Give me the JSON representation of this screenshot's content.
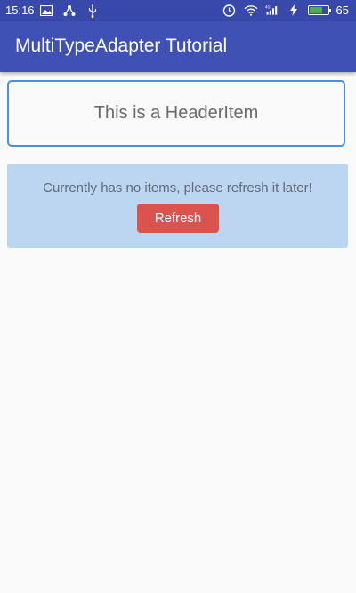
{
  "status_bar": {
    "time": "15:16",
    "battery_level": "65",
    "icons": [
      "image-icon",
      "share-icon",
      "usb-icon",
      "alarm-icon",
      "wifi-icon",
      "4g-signal-icon",
      "charging-icon",
      "battery-icon"
    ]
  },
  "app_bar": {
    "title": "MultiTypeAdapter Tutorial",
    "color": "#3f51b5"
  },
  "header_item": {
    "text": "This is a HeaderItem",
    "border_color": "#4a90e2"
  },
  "empty_state": {
    "message": "Currently has no items, please refresh it later!",
    "refresh_label": "Refresh",
    "background": "#bcd6f2",
    "button_color": "#d9534f"
  }
}
